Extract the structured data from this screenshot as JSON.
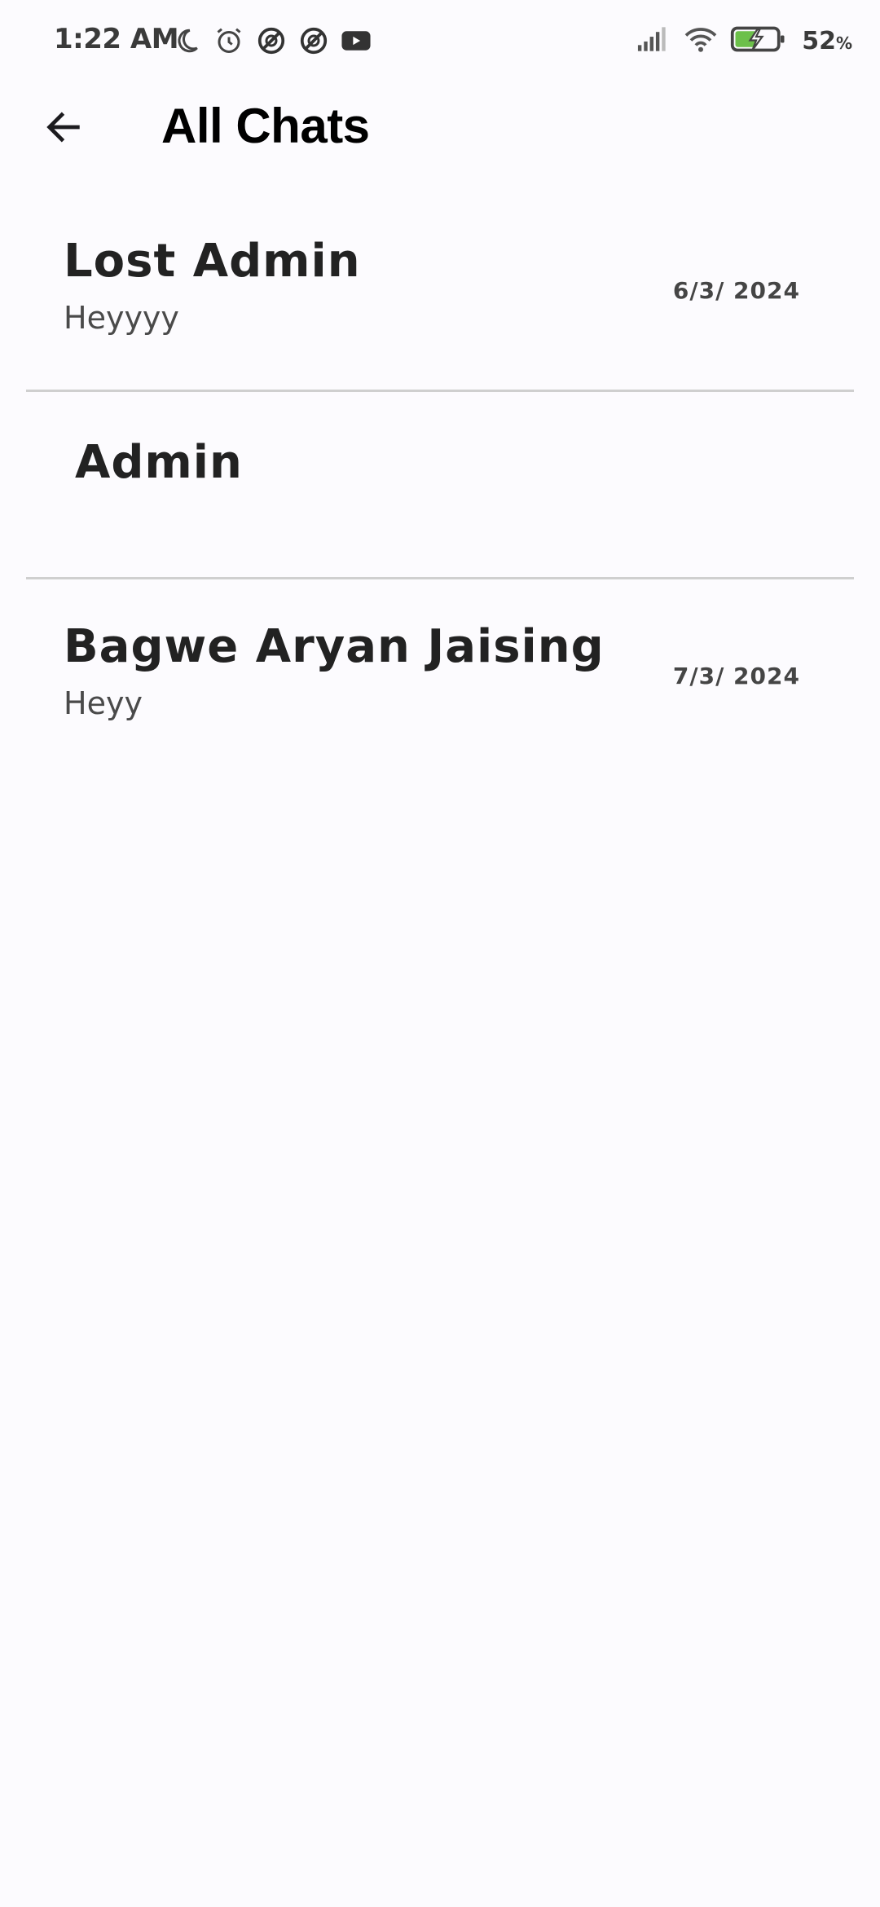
{
  "status_bar": {
    "time": "1:22 AM",
    "left_icons": [
      "moon-icon",
      "alarm-icon",
      "no-disturb-icon",
      "no-disturb-icon",
      "youtube-icon"
    ],
    "right_icons": [
      "signal-icon",
      "wifi-icon",
      "battery-charging-icon"
    ],
    "battery_percent": "52",
    "battery_unit": "%",
    "battery_level": 0.52,
    "battery_color": "#6cc04a"
  },
  "app_bar": {
    "back_icon": "arrow-back-icon",
    "title": "All Chats"
  },
  "chats": [
    {
      "name": "Lost Admin",
      "last_message": "Heyyyy",
      "date": "6/3/ 2024"
    },
    {
      "name": "Admin",
      "last_message": "",
      "date": ""
    },
    {
      "name": "Bagwe Aryan Jaising",
      "last_message": "Heyy",
      "date": "7/3/ 2024"
    }
  ],
  "colors": {
    "background": "#fcfbfe",
    "divider": "#cfcfcf",
    "title": "#000000",
    "name": "#222222",
    "message": "#4a4a4a"
  }
}
